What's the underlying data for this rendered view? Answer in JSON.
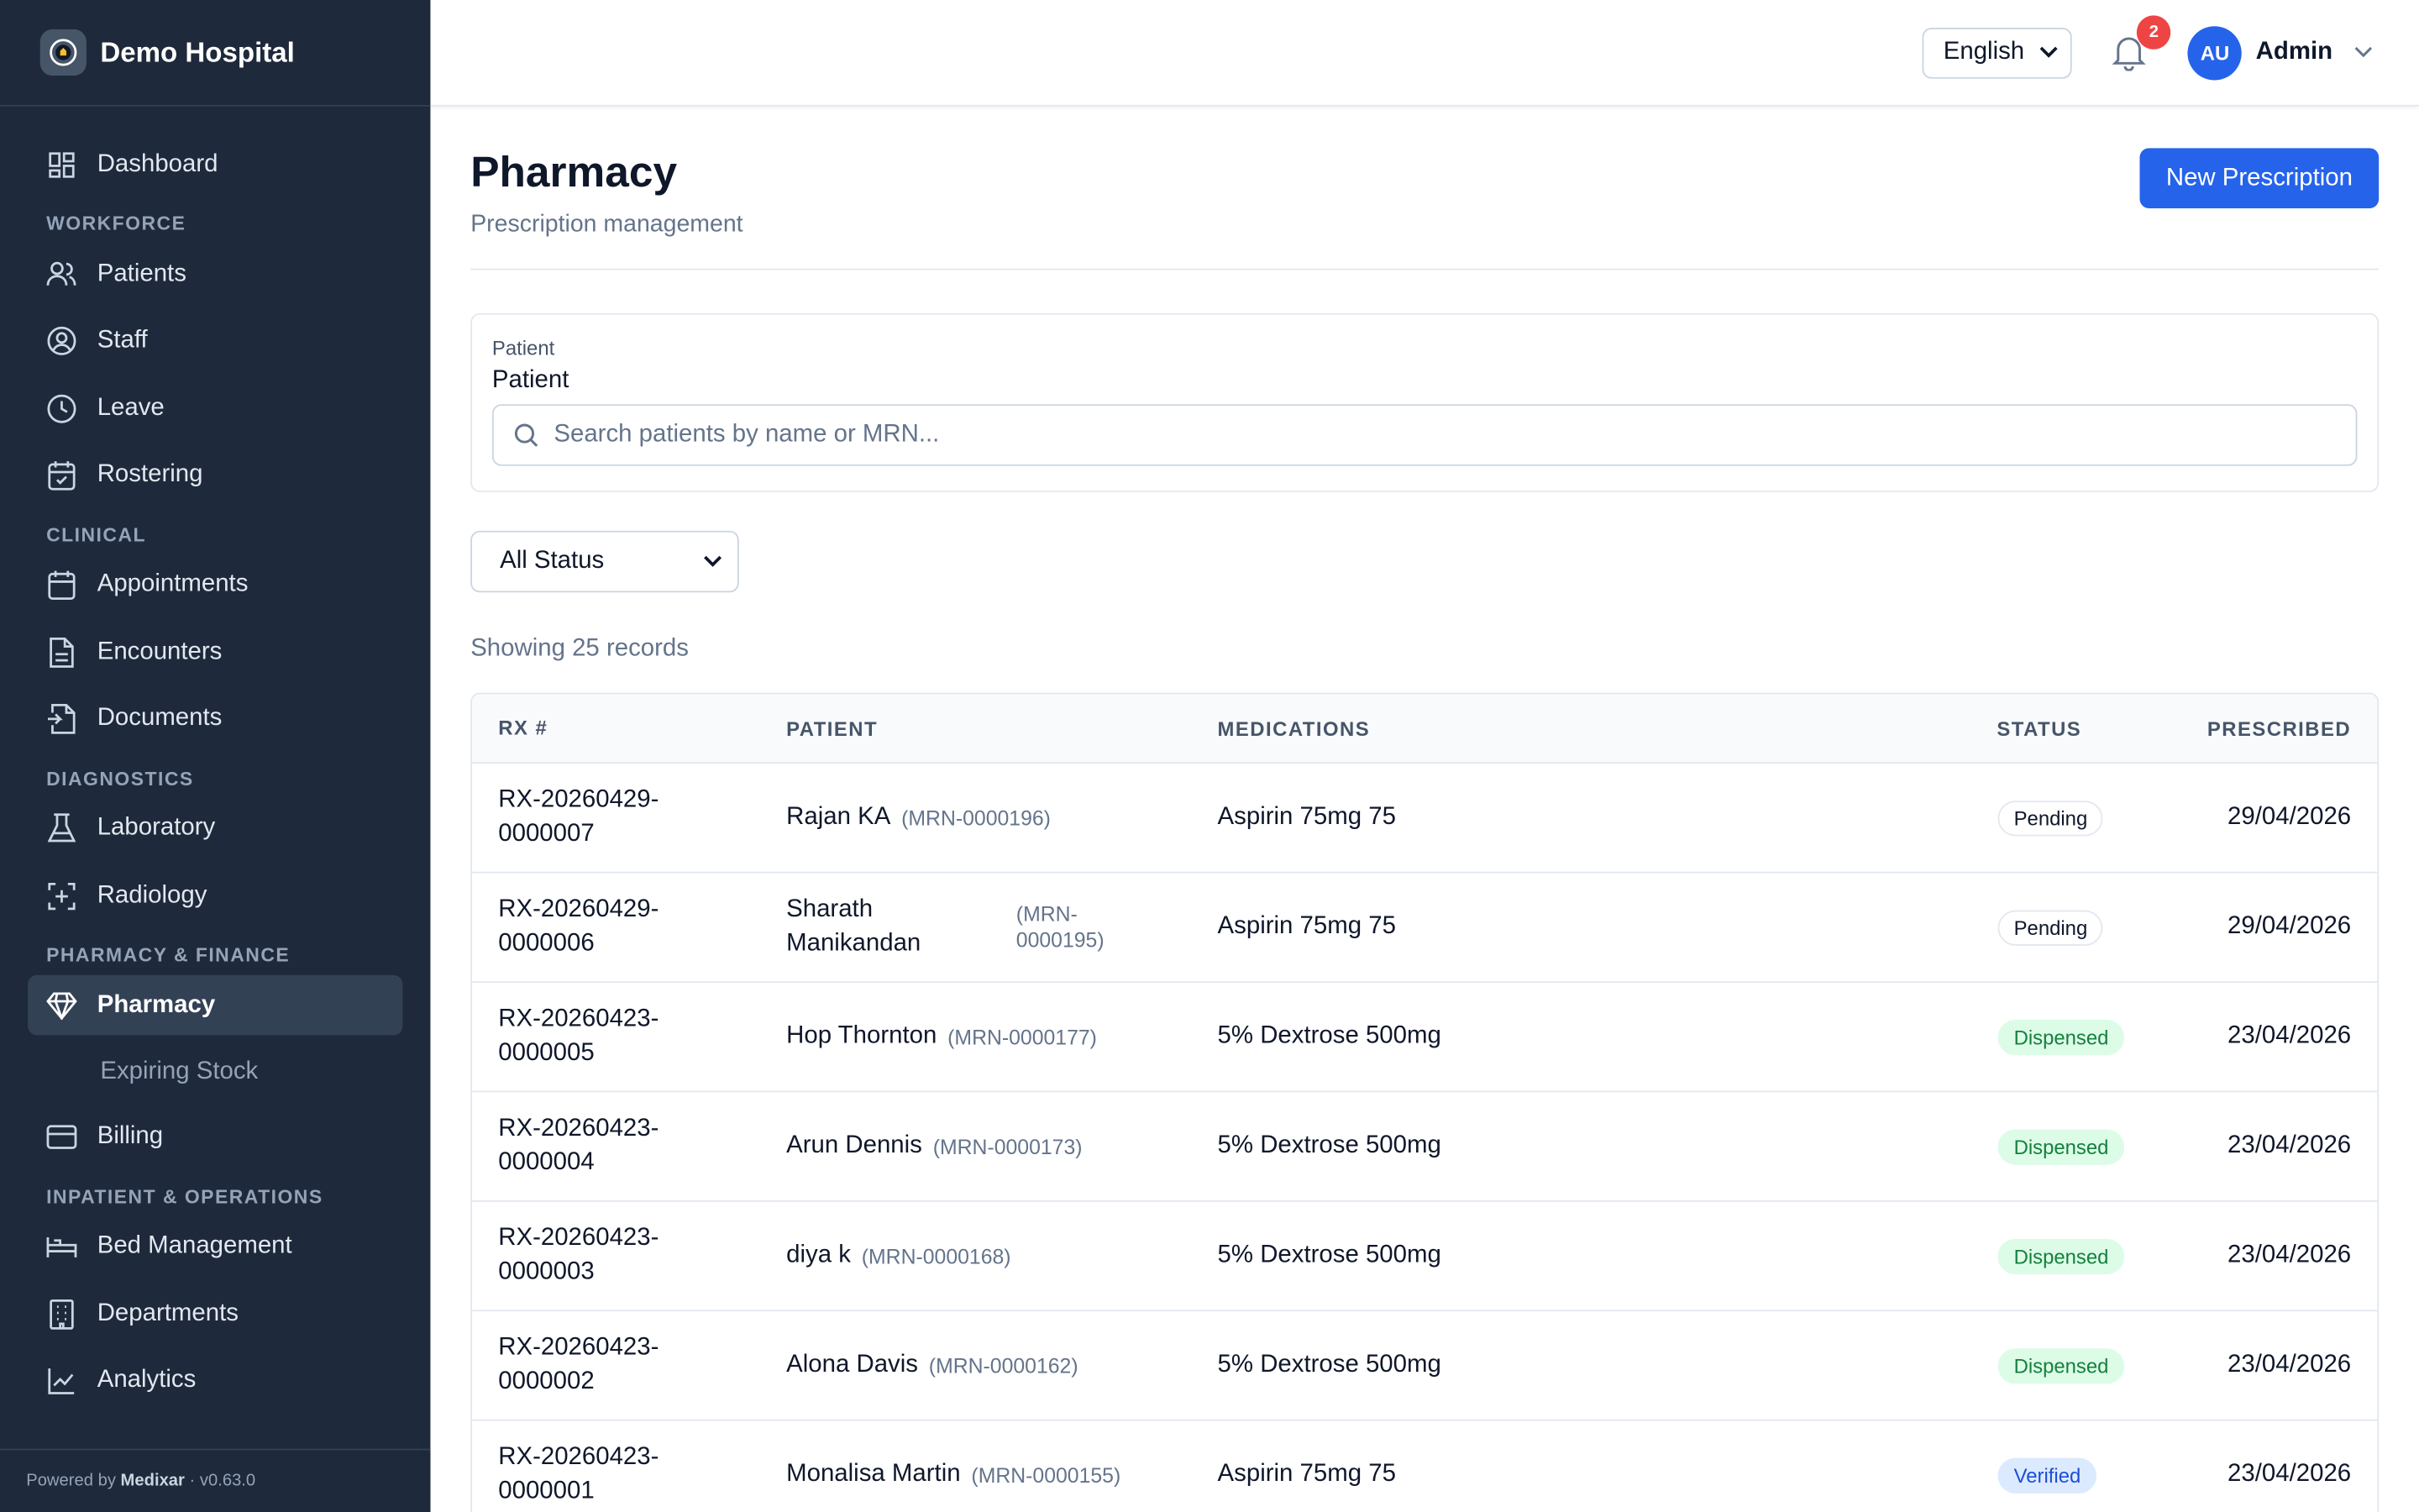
{
  "brand": {
    "name": "Demo Hospital"
  },
  "sidebar": {
    "dashboard": "Dashboard",
    "sections": {
      "workforce": "WORKFORCE",
      "clinical": "CLINICAL",
      "diagnostics": "DIAGNOSTICS",
      "pharmacy_finance": "PHARMACY & FINANCE",
      "inpatient_operations": "INPATIENT & OPERATIONS"
    },
    "items": {
      "patients": "Patients",
      "staff": "Staff",
      "leave": "Leave",
      "rostering": "Rostering",
      "appointments": "Appointments",
      "encounters": "Encounters",
      "documents": "Documents",
      "laboratory": "Laboratory",
      "radiology": "Radiology",
      "pharmacy": "Pharmacy",
      "expiring_stock": "Expiring Stock",
      "billing": "Billing",
      "bed_management": "Bed Management",
      "departments": "Departments",
      "analytics": "Analytics"
    },
    "footer": {
      "powered_by": "Powered by",
      "vendor": "Medixar",
      "version": "· v0.63.0"
    }
  },
  "topbar": {
    "language": "English",
    "notification_count": "2",
    "avatar_initials": "AU",
    "user_name": "Admin"
  },
  "page": {
    "title": "Pharmacy",
    "subtitle": "Prescription management",
    "new_button": "New Prescription"
  },
  "filter": {
    "small_label": "Patient",
    "label": "Patient",
    "search_placeholder": "Search patients by name or MRN...",
    "status_value": "All Status"
  },
  "records_text": "Showing 25 records",
  "table": {
    "headers": [
      "RX #",
      "PATIENT",
      "MEDICATIONS",
      "STATUS",
      "PRESCRIBED"
    ],
    "rows": [
      {
        "rx_line1": "RX-20260429-",
        "rx_line2": "0000007",
        "patient": "Rajan KA",
        "mrn": "(MRN-0000196)",
        "medication": "Aspirin 75mg 75",
        "status": "Pending",
        "date": "29/04/2026"
      },
      {
        "rx_line1": "RX-20260429-",
        "rx_line2": "0000006",
        "patient_line1": "Sharath",
        "patient_line2": "Manikandan",
        "mrn_line1": "(MRN-",
        "mrn_line2": "0000195)",
        "medication": "Aspirin 75mg 75",
        "status": "Pending",
        "date": "29/04/2026"
      },
      {
        "rx_line1": "RX-20260423-",
        "rx_line2": "0000005",
        "patient": "Hop Thornton",
        "mrn": "(MRN-0000177)",
        "medication": "5% Dextrose 500mg",
        "status": "Dispensed",
        "date": "23/04/2026"
      },
      {
        "rx_line1": "RX-20260423-",
        "rx_line2": "0000004",
        "patient": "Arun Dennis",
        "mrn": "(MRN-0000173)",
        "medication": "5% Dextrose 500mg",
        "status": "Dispensed",
        "date": "23/04/2026"
      },
      {
        "rx_line1": "RX-20260423-",
        "rx_line2": "0000003",
        "patient": "diya k",
        "mrn": "(MRN-0000168)",
        "medication": "5% Dextrose 500mg",
        "status": "Dispensed",
        "date": "23/04/2026"
      },
      {
        "rx_line1": "RX-20260423-",
        "rx_line2": "0000002",
        "patient": "Alona Davis",
        "mrn": "(MRN-0000162)",
        "medication": "5% Dextrose 500mg",
        "status": "Dispensed",
        "date": "23/04/2026"
      },
      {
        "rx_line1": "RX-20260423-",
        "rx_line2": "0000001",
        "patient": "Monalisa Martin",
        "mrn": "(MRN-0000155)",
        "medication": "Aspirin 75mg 75",
        "status": "Verified",
        "date": "23/04/2026"
      }
    ]
  },
  "colors": {
    "sidebar_bg": "#1e293b",
    "primary": "#2563eb",
    "badge_red": "#ef4444",
    "dispensed_bg": "#dcfce7",
    "verified_bg": "#dbeafe"
  }
}
